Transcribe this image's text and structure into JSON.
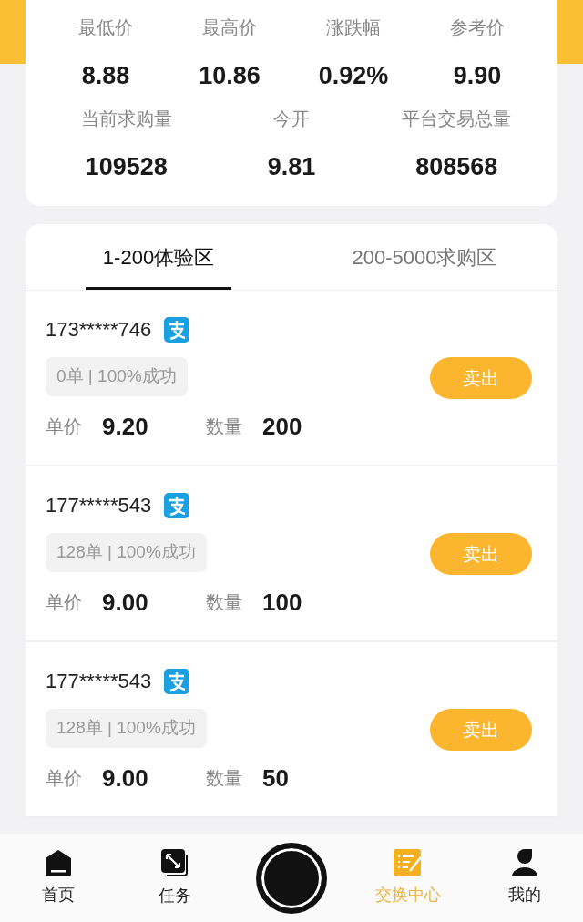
{
  "stats": [
    {
      "label": "最低价",
      "value": "8.88"
    },
    {
      "label": "最高价",
      "value": "10.86"
    },
    {
      "label": "涨跌幅",
      "value": "0.92%"
    },
    {
      "label": "参考价",
      "value": "9.90"
    }
  ],
  "stats_row_2": [
    {
      "label": "当前求购量",
      "value": "109528"
    },
    {
      "label": "今开",
      "value": "9.81"
    },
    {
      "label": "平台交易总量",
      "value": "808568"
    }
  ],
  "tabs": [
    {
      "label": "1-200体验区",
      "selected": true
    },
    {
      "label": "200-5000求购区",
      "selected": false
    }
  ],
  "orders": [
    {
      "user": "173*****746",
      "record": "0单 | 100%成功",
      "price_label": "单价",
      "price": "9.20",
      "qty_label": "数量",
      "qty": "200",
      "button": "卖出"
    },
    {
      "user": "177*****543",
      "record": "128单 | 100%成功",
      "price_label": "单价",
      "price": "9.00",
      "qty_label": "数量",
      "qty": "100",
      "button": "卖出"
    },
    {
      "user": "177*****543",
      "record": "128单 | 100%成功",
      "price_label": "单价",
      "price": "9.00",
      "qty_label": "数量",
      "qty": "50",
      "button": "卖出"
    }
  ],
  "nav": [
    {
      "kind": "home",
      "label": "首页",
      "selected": false
    },
    {
      "kind": "tasks",
      "label": "任务",
      "selected": false
    },
    {
      "kind": "center",
      "selected": false
    },
    {
      "kind": "exchange",
      "label": "交换中心",
      "selected": true
    },
    {
      "kind": "profile",
      "label": "我的",
      "selected": false
    }
  ]
}
